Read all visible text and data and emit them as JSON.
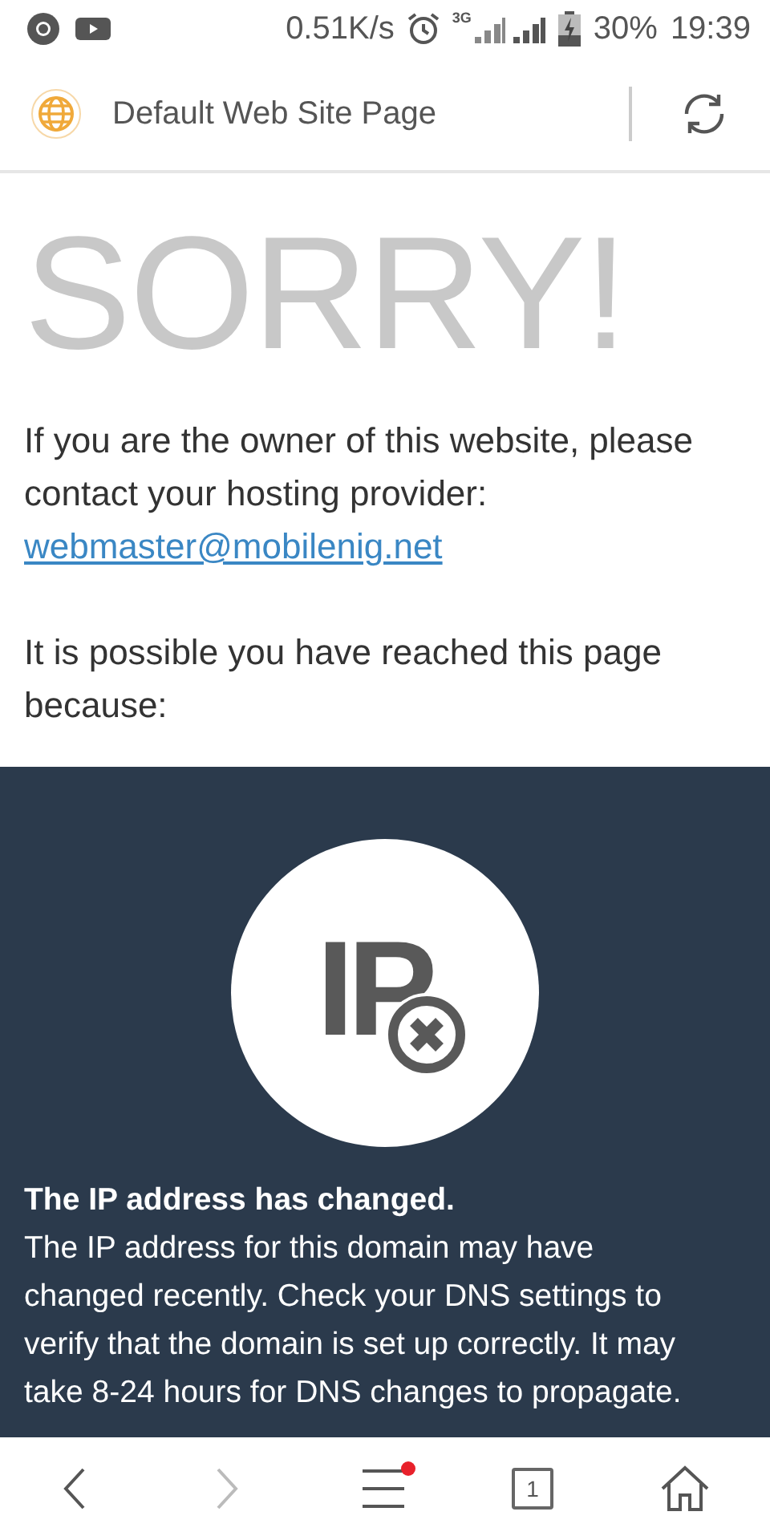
{
  "status_bar": {
    "speed": "0.51K/s",
    "network": "3G",
    "battery": "30%",
    "time": "19:39",
    "battery_charging": true
  },
  "toolbar": {
    "title": "Default Web Site Page"
  },
  "page": {
    "heading": "SORRY!",
    "owner_text": "If you are the owner of this website, please contact your hosting provider:",
    "email": "webmaster@mobilenig.net",
    "reason_intro": "It is possible you have reached this page because:",
    "reason": {
      "icon_text": "IP",
      "title": "The IP address has changed.",
      "body": "The IP address for this domain may have changed recently. Check your DNS settings to verify that the domain is set up correctly. It may take 8-24 hours for DNS changes to propagate."
    }
  },
  "bottom_bar": {
    "back_disabled": false,
    "forward_disabled": true,
    "menu_notification": true,
    "tab_count": "1"
  }
}
